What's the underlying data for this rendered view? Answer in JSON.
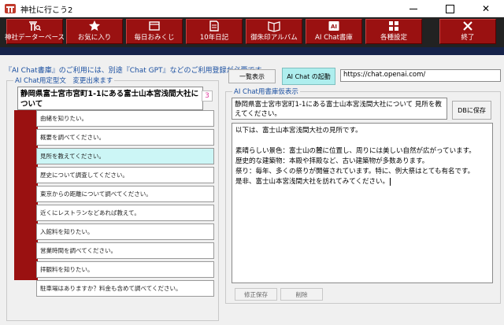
{
  "window": {
    "title": "神社に行こう2",
    "minimize_icon": "minimize-icon",
    "maximize_icon": "maximize-icon",
    "close_glyph": "✕"
  },
  "toolbar": {
    "buttons": [
      {
        "label": "神社データーベース",
        "icon": "shrine-search-icon"
      },
      {
        "label": "お気に入り",
        "icon": "star-icon"
      },
      {
        "label": "毎日おみくじ",
        "icon": "omikuji-icon"
      },
      {
        "label": "10年日記",
        "icon": "diary-icon"
      },
      {
        "label": "御朱印アルバム",
        "icon": "album-icon"
      },
      {
        "label": "AI Chat書庫",
        "icon": "ai-icon"
      },
      {
        "label": "各種設定",
        "icon": "grid-icon"
      },
      {
        "label": "終了",
        "icon": "close-x-icon"
      }
    ],
    "button_color": "#9a1111"
  },
  "notice": "『AI Chat書庫』のご利用には、別途『Chat GPT』などのご利用登録が必要です。",
  "left_panel": {
    "legend": "AI Chat用定型文　変更出来ます",
    "prompt_text": "静岡県富士宮市宮町1-1にある富士山本宮浅間大社について",
    "prompt_number": "3",
    "questions": [
      "由緒を知りたい。",
      "概要を調べてください。",
      "見所を教えてください。",
      "歴史について調査してください。",
      "東京からの距離について調べてください。",
      "近くにレストランなどあれば教えて。",
      "入館料を知りたい。",
      "営業時間を調べてください。",
      "拝観料を知りたい。",
      "駐車場はありますか？料金も含めて調べてください。"
    ],
    "active_index": 2
  },
  "top_controls": {
    "list_button": "一覧表示",
    "ai_chat_button": "AI Chat の起動",
    "url_value": "https://chat.openai.com/"
  },
  "right_panel": {
    "legend": "AI Chat用書庫仮表示",
    "request_text": "静岡県富士宮市宮町1-1にある富士山本宮浅間大社について 見所を教えてください。",
    "db_save_button": "DBに保存",
    "response_lines": [
      "以下は、富士山本宮浅間大社の見所です。",
      "",
      "素晴らしい景色：富士山の麓に位置し、周りには美しい自然が広がっています。",
      "歴史的な建築物：本殿や拝殿など、古い建築物が多数あります。",
      "祭り：毎年、多くの祭りが開催されています。特に、例大祭はとても有名です。",
      "是非、富士山本宮浅間大社を訪れてみてください。"
    ],
    "edit_save_button": "修正保存",
    "delete_button": "削除"
  }
}
